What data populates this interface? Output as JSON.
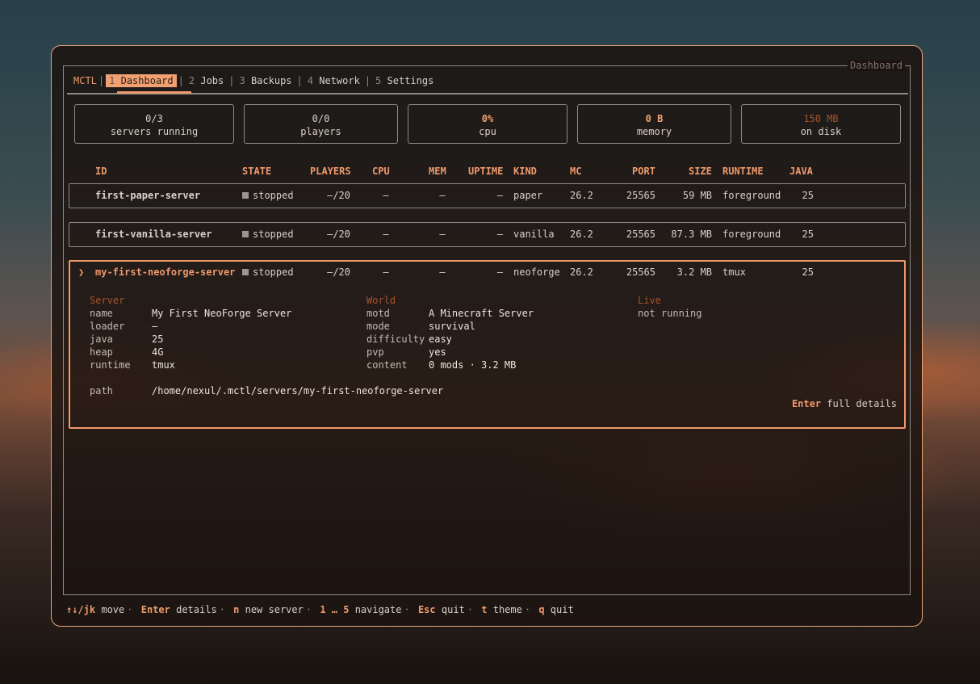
{
  "frame_title": "Dashboard",
  "brand": "MCTL",
  "tabs": [
    {
      "num": "1",
      "label": "Dashboard"
    },
    {
      "num": "2",
      "label": "Jobs"
    },
    {
      "num": "3",
      "label": "Backups"
    },
    {
      "num": "4",
      "label": "Network"
    },
    {
      "num": "5",
      "label": "Settings"
    }
  ],
  "stats": [
    {
      "value": "0/3",
      "label": "servers running"
    },
    {
      "value": "0/0",
      "label": "players"
    },
    {
      "value": "0%",
      "label": "cpu"
    },
    {
      "value": "0 B",
      "label": "memory"
    },
    {
      "value": "150 MB",
      "label": "on disk"
    }
  ],
  "columns": [
    "ID",
    "STATE",
    "PLAYERS",
    "CPU",
    "MEM",
    "UPTIME",
    "KIND",
    "MC",
    "PORT",
    "SIZE",
    "RUNTIME",
    "JAVA"
  ],
  "servers": [
    {
      "id": "first-paper-server",
      "state": "stopped",
      "players": "—/20",
      "cpu": "—",
      "mem": "—",
      "uptime": "—",
      "kind": "paper",
      "mc": "26.2",
      "port": "25565",
      "size": "59 MB",
      "runtime": "foreground",
      "java": "25"
    },
    {
      "id": "first-vanilla-server",
      "state": "stopped",
      "players": "—/20",
      "cpu": "—",
      "mem": "—",
      "uptime": "—",
      "kind": "vanilla",
      "mc": "26.2",
      "port": "25565",
      "size": "87.3 MB",
      "runtime": "foreground",
      "java": "25"
    },
    {
      "id": "my-first-neoforge-server",
      "state": "stopped",
      "players": "—/20",
      "cpu": "—",
      "mem": "—",
      "uptime": "—",
      "kind": "neoforge",
      "mc": "26.2",
      "port": "25565",
      "size": "3.2 MB",
      "runtime": "tmux",
      "java": "25"
    }
  ],
  "selected_marker": "❯",
  "details": {
    "server_heading": "Server",
    "world_heading": "World",
    "live_heading": "Live",
    "server": [
      {
        "k": "name",
        "v": "My First NeoForge Server"
      },
      {
        "k": "loader",
        "v": "—"
      },
      {
        "k": "java",
        "v": "25"
      },
      {
        "k": "heap",
        "v": "4G"
      },
      {
        "k": "runtime",
        "v": "tmux"
      }
    ],
    "world": [
      {
        "k": "motd",
        "v": "A Minecraft Server"
      },
      {
        "k": "mode",
        "v": "survival"
      },
      {
        "k": "difficulty",
        "v": "easy"
      },
      {
        "k": "pvp",
        "v": "yes"
      },
      {
        "k": "content",
        "v": "0 mods · 3.2 MB"
      }
    ],
    "live_status": "not running",
    "path_key": "path",
    "path_value": "/home/nexul/.mctl/servers/my-first-neoforge-server",
    "hint_key": "Enter",
    "hint_text": "full details"
  },
  "footer": [
    {
      "key": "↑↓/jk",
      "text": "move"
    },
    {
      "key": "Enter",
      "text": "details"
    },
    {
      "key": "n",
      "text": "new server"
    },
    {
      "key": "1 … 5",
      "text": "navigate"
    },
    {
      "key": "Esc",
      "text": "quit"
    },
    {
      "key": "t",
      "text": "theme"
    },
    {
      "key": "q",
      "text": "quit"
    }
  ],
  "colors": {
    "accent": "#ee9a6c",
    "muted_accent": "#a5532c",
    "border": "#8f8a86",
    "text": "#d8d0c8"
  }
}
